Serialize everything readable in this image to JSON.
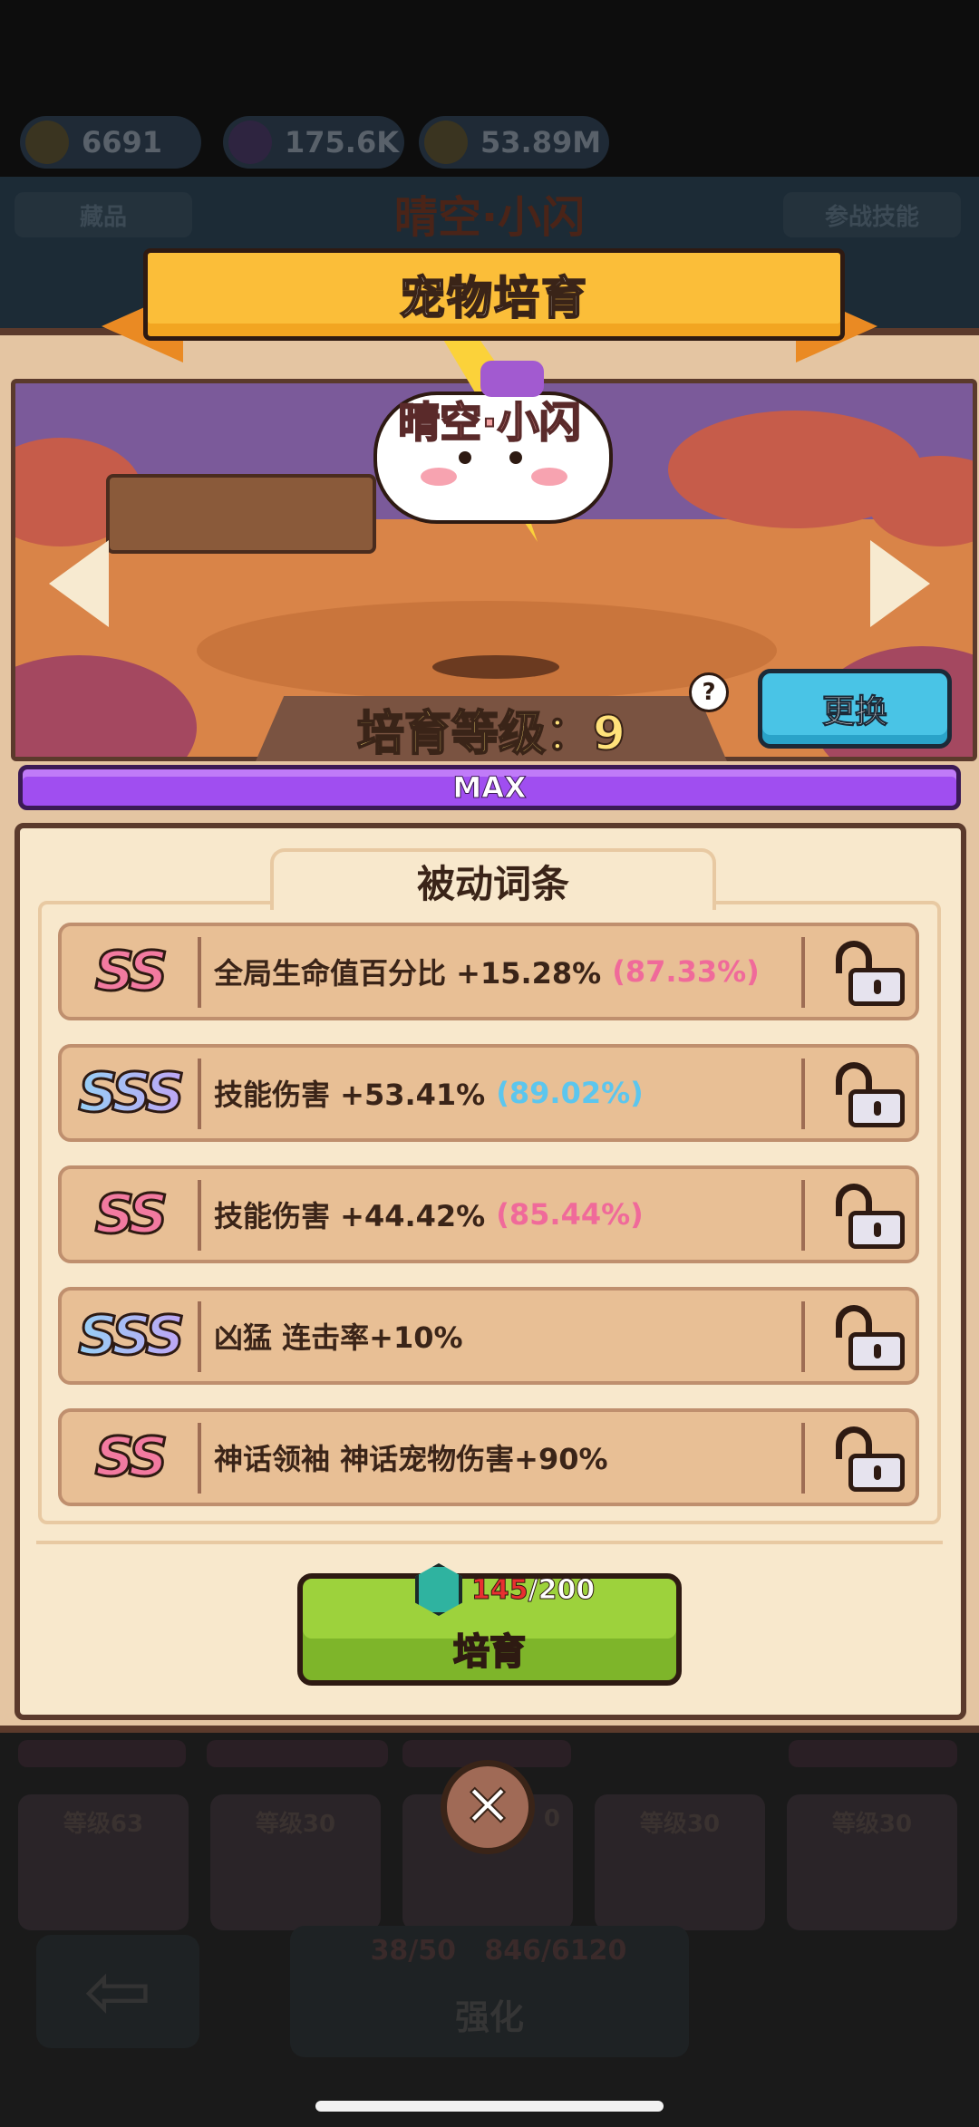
{
  "resources": [
    {
      "icon": "gold-coin-pile-icon",
      "value": "6691"
    },
    {
      "icon": "purple-cube-icon",
      "value": "175.6K"
    },
    {
      "icon": "gold-key-icon",
      "value": "53.89M"
    }
  ],
  "background": {
    "tab_left": "藏品",
    "tab_right": "参战技能",
    "pet_name": "晴空·小闪",
    "cards": [
      {
        "label": "等级63"
      },
      {
        "label": "等级30"
      },
      {
        "label": "0"
      },
      {
        "label": "等级30"
      },
      {
        "label": "等级30"
      }
    ],
    "upgrade_cost_a": "38/50",
    "upgrade_cost_b": "846/6120",
    "upgrade_label": "强化"
  },
  "dialog": {
    "title": "宠物培育",
    "pet_name": "晴空·小闪",
    "level_text": "培育等级：9",
    "swap_label": "更换",
    "help_label": "?",
    "progress_label": "MAX",
    "progress": 1.0,
    "section_title": "被动词条",
    "passives": [
      {
        "grade": "SS",
        "tier": "ss",
        "text": "全局生命值百分比 +15.28%",
        "pct": "(87.33%)",
        "pct_color": "pink"
      },
      {
        "grade": "SSS",
        "tier": "sss",
        "text": "技能伤害 +53.41%",
        "pct": "(89.02%)",
        "pct_color": "blue"
      },
      {
        "grade": "SS",
        "tier": "ss",
        "text": "技能伤害 +44.42%",
        "pct": "(85.44%)",
        "pct_color": "pink"
      },
      {
        "grade": "SSS",
        "tier": "sss",
        "text": "凶猛 连击率+10%",
        "pct": "",
        "pct_color": ""
      },
      {
        "grade": "SS",
        "tier": "ss",
        "text": "神话领袖 神话宠物伤害+90%",
        "pct": "",
        "pct_color": ""
      }
    ],
    "cost_current": "145",
    "cost_total": "/200",
    "train_label": "培育",
    "close_label": "✕"
  }
}
